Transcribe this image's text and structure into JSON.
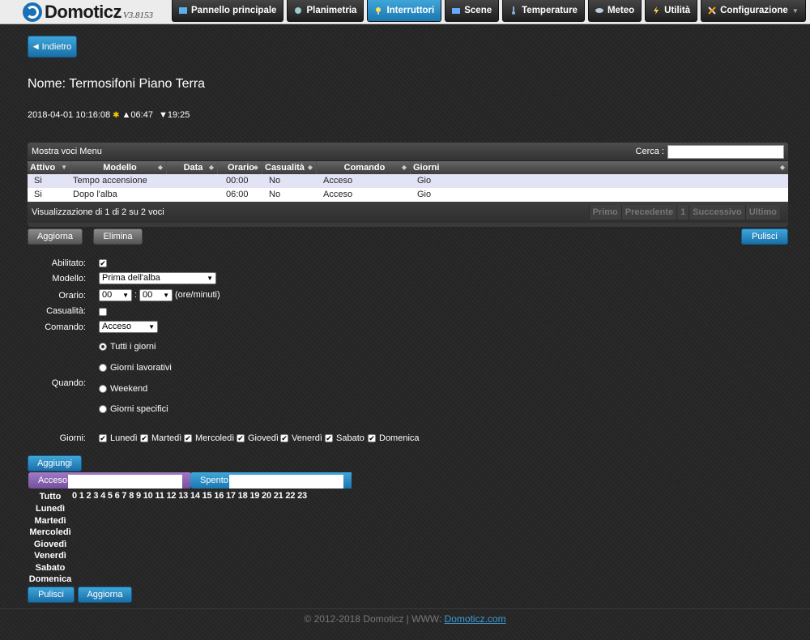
{
  "app": {
    "name": "Domoticz",
    "version": "V3.8153"
  },
  "nav": [
    {
      "label": "Pannello principale",
      "icon": "dashboard-icon",
      "active": false
    },
    {
      "label": "Planimetria",
      "icon": "floorplan-icon",
      "active": false
    },
    {
      "label": "Interruttori",
      "icon": "lightbulb-icon",
      "active": true
    },
    {
      "label": "Scene",
      "icon": "scene-icon",
      "active": false
    },
    {
      "label": "Temperature",
      "icon": "thermometer-icon",
      "active": false
    },
    {
      "label": "Meteo",
      "icon": "weather-icon",
      "active": false
    },
    {
      "label": "Utilità",
      "icon": "utility-icon",
      "active": false
    },
    {
      "label": "Configurazione",
      "icon": "tools-icon",
      "active": false
    }
  ],
  "back_label": "Indietro",
  "device_title": "Nome: Termosifoni Piano Terra",
  "info": {
    "datetime": "2018-04-01 10:16:08",
    "sunrise": "▲06:47",
    "sunset": "▼19:25"
  },
  "table": {
    "show_menu": "Mostra voci Menu",
    "search_label": "Cerca :",
    "columns": [
      "Attivo",
      "Modello",
      "Data",
      "Orario",
      "Casualità",
      "Comando",
      "Giorni"
    ],
    "rows": [
      [
        "Si",
        "Tempo accensione",
        "",
        "00:00",
        "No",
        "Acceso",
        "Gio"
      ],
      [
        "Si",
        "Dopo l'alba",
        "",
        "06:00",
        "No",
        "Acceso",
        "Gio"
      ]
    ],
    "info": "Visualizzazione di 1 di 2 su 2 voci",
    "pager": [
      "Primo",
      "Precedente",
      "1",
      "Successivo",
      "Ultimo"
    ]
  },
  "buttons": {
    "update": "Aggiorna",
    "delete": "Elimina",
    "clear": "Pulisci",
    "add": "Aggiungi"
  },
  "form": {
    "enabled_label": "Abilitato:",
    "model_label": "Modello:",
    "model_value": "Prima dell'alba",
    "time_label": "Orario:",
    "hour_value": "00",
    "minute_value": "00",
    "time_sep": ":",
    "time_unit": "(ore/minuti)",
    "random_label": "Casualità:",
    "command_label": "Comando:",
    "command_value": "Acceso",
    "when_label": "Quando:",
    "when_options": [
      "Tutti i giorni",
      "Giorni lavorativi",
      "Weekend",
      "Giorni specifici"
    ],
    "days_label": "Giorni:",
    "days": [
      "Lunedì",
      "Martedì",
      "Mercoledì",
      "Giovedì",
      "Venerdì",
      "Sabato",
      "Domenica"
    ]
  },
  "timeline": {
    "on_label": "Acceso",
    "off_label": "Spento",
    "all_label": "Tutto",
    "hours": "0 1 2 3 4 5 6 7 8 9 10 11 12 13 14 15 16 17 18 19 20 21 22 23",
    "days": [
      "Lunedì",
      "Martedì",
      "Mercoledì",
      "Giovedì",
      "Venerdì",
      "Sabato",
      "Domenica"
    ]
  },
  "footer": {
    "text": "© 2012-2018 Domoticz | WWW:",
    "link": "Domoticz.com"
  },
  "colors": {
    "accent": "#2a8ac8",
    "on_bar": "#8a60b4",
    "off_bar": "#2a8ac8"
  }
}
